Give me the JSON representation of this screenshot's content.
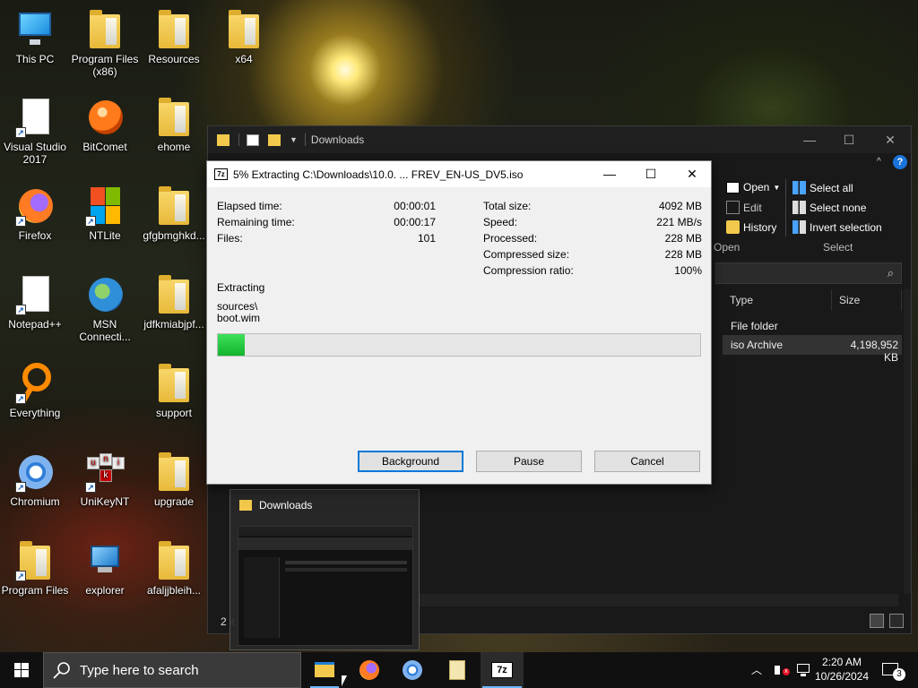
{
  "desktop": {
    "icons": [
      {
        "label": "This PC"
      },
      {
        "label": "Program Files (x86)"
      },
      {
        "label": "Resources"
      },
      {
        "label": "x64"
      },
      {
        "label": "Visual Studio 2017"
      },
      {
        "label": "BitComet"
      },
      {
        "label": "ehome"
      },
      {
        "label": "Firefox"
      },
      {
        "label": "NTLite"
      },
      {
        "label": "gfgbmghkd..."
      },
      {
        "label": "Notepad++"
      },
      {
        "label": "MSN Connecti..."
      },
      {
        "label": "jdfkmiabjpf..."
      },
      {
        "label": "Everything"
      },
      {
        "label": "support"
      },
      {
        "label": "Chromium"
      },
      {
        "label": "UniKeyNT"
      },
      {
        "label": "upgrade"
      },
      {
        "label": "Program Files"
      },
      {
        "label": "explorer"
      },
      {
        "label": "afaljjbleih..."
      }
    ]
  },
  "explorer": {
    "title": "Downloads",
    "minimize": "—",
    "maximize": "☐",
    "close": "✕",
    "ribbon": {
      "open_label": "Open",
      "edit_label": "Edit",
      "history_label": "History",
      "open_group": "Open",
      "select_all": "Select all",
      "select_none": "Select none",
      "invert_selection": "Invert selection",
      "select_group": "Select"
    },
    "columns": {
      "type": "Type",
      "size": "Size"
    },
    "rows": [
      {
        "type": "File folder",
        "size": ""
      },
      {
        "type": "iso Archive",
        "size": "4,198,952 KB"
      }
    ],
    "status": "2 it"
  },
  "thumbnail": {
    "title": "Downloads"
  },
  "dialog": {
    "title": "5% Extracting C:\\Downloads\\10.0. ... FREV_EN-US_DV5.iso",
    "left_stats": [
      {
        "label": "Elapsed time:",
        "value": "00:00:01"
      },
      {
        "label": "Remaining time:",
        "value": "00:00:17"
      },
      {
        "label": "Files:",
        "value": "101"
      }
    ],
    "right_stats": [
      {
        "label": "Total size:",
        "value": "4092 MB"
      },
      {
        "label": "Speed:",
        "value": "221 MB/s"
      },
      {
        "label": "Processed:",
        "value": "228 MB"
      },
      {
        "label": "Compressed size:",
        "value": "228 MB"
      },
      {
        "label": "Compression ratio:",
        "value": "100%"
      }
    ],
    "operation": "Extracting",
    "current_path": "sources\\",
    "current_file": "boot.wim",
    "progress_fraction": 0.055,
    "buttons": {
      "background": "Background",
      "pause": "Pause",
      "cancel": "Cancel"
    }
  },
  "taskbar": {
    "search_placeholder": "Type here to search",
    "time": "2:20 AM",
    "date": "10/26/2024",
    "notification_count": "3",
    "apps": [
      "file-explorer",
      "firefox",
      "chromium",
      "notepad",
      "7-zip"
    ]
  }
}
